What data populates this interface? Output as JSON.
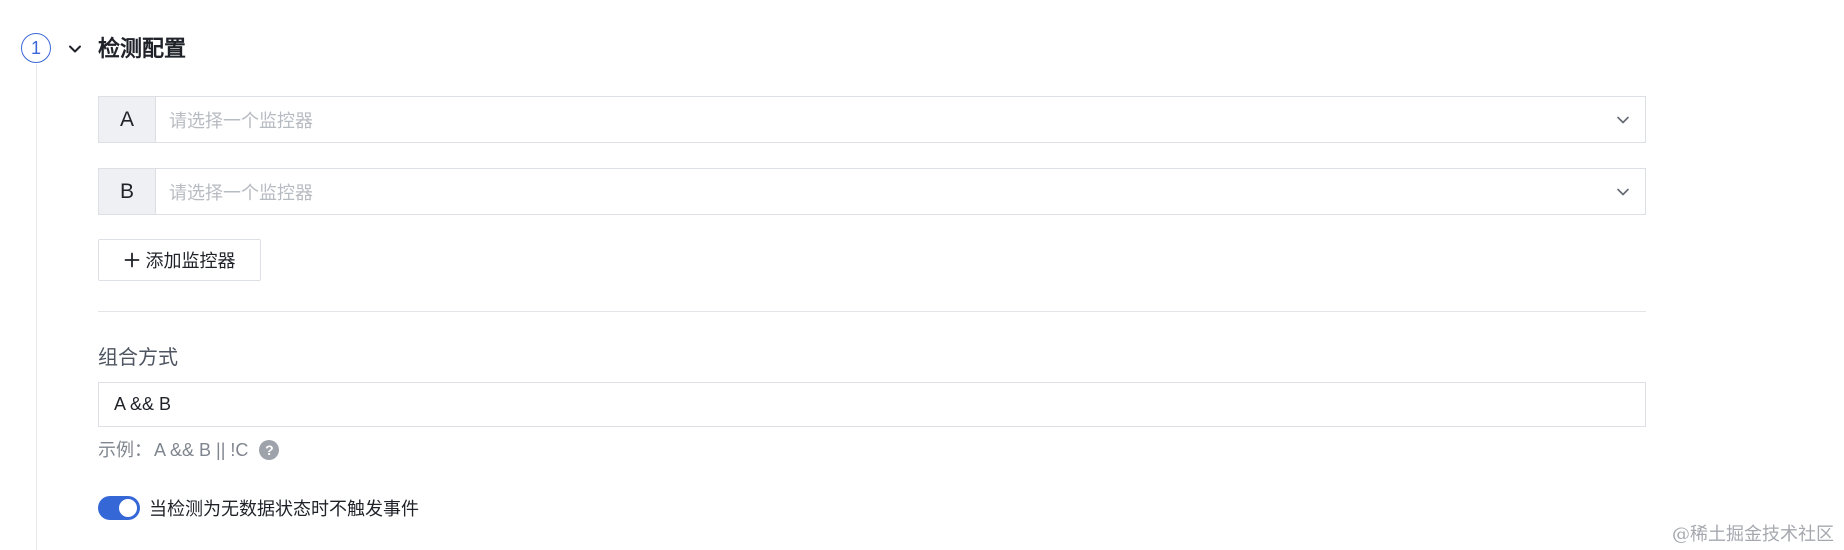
{
  "step": {
    "number": "1",
    "title": "检测配置",
    "collapse_icon": "chevron-down-icon",
    "accent_color": "#3b68d8"
  },
  "monitors": [
    {
      "letter": "A",
      "placeholder": "请选择一个监控器"
    },
    {
      "letter": "B",
      "placeholder": "请选择一个监控器"
    }
  ],
  "add_button": {
    "icon": "plus-icon",
    "label": "添加监控器"
  },
  "combination": {
    "label": "组合方式",
    "value": "A && B",
    "example_prefix": "示例：",
    "example_value": "A && B || !C",
    "help_icon": "question-circle-icon",
    "help_glyph": "?"
  },
  "no_data_toggle": {
    "enabled": true,
    "label": "当检测为无数据状态时不触发事件",
    "color": "#3667d6"
  },
  "watermark": "@稀土掘金技术社区"
}
